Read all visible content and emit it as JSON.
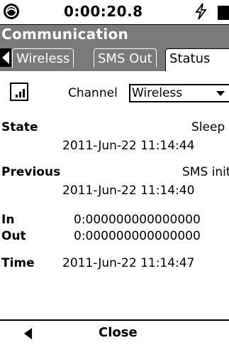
{
  "status_bar": {
    "clock": "0:00:20.8",
    "charging_symbol": "⚡"
  },
  "window": {
    "title": "Communication"
  },
  "tabs": [
    {
      "label": "Wireless",
      "active": false
    },
    {
      "label": "SMS Out",
      "active": false
    },
    {
      "label": "Status",
      "active": true
    }
  ],
  "channel": {
    "label": "Channel",
    "value": "Wireless"
  },
  "fields": {
    "state": {
      "label": "State",
      "value": "Sleep",
      "timestamp": "2011-Jun-22 11:14:44"
    },
    "previous": {
      "label": "Previous",
      "value": "SMS init",
      "timestamp": "2011-Jun-22 11:14:40"
    },
    "in": {
      "label": "In",
      "value": "0:000000000000000"
    },
    "out": {
      "label": "Out",
      "value": "0:000000000000000"
    },
    "time": {
      "label": "Time",
      "value": "2011-Jun-22 11:14:47"
    }
  },
  "bottom_bar": {
    "close_label": "Close"
  },
  "icons": [
    "logo-icon",
    "charging-icon",
    "battery-icon",
    "tab-scroll-left-icon",
    "signal-strength-icon",
    "dropdown-caret-icon",
    "back-icon"
  ],
  "colors": {
    "title_bar": "#7a7a7a",
    "background": "#ffffff",
    "text": "#000000"
  }
}
